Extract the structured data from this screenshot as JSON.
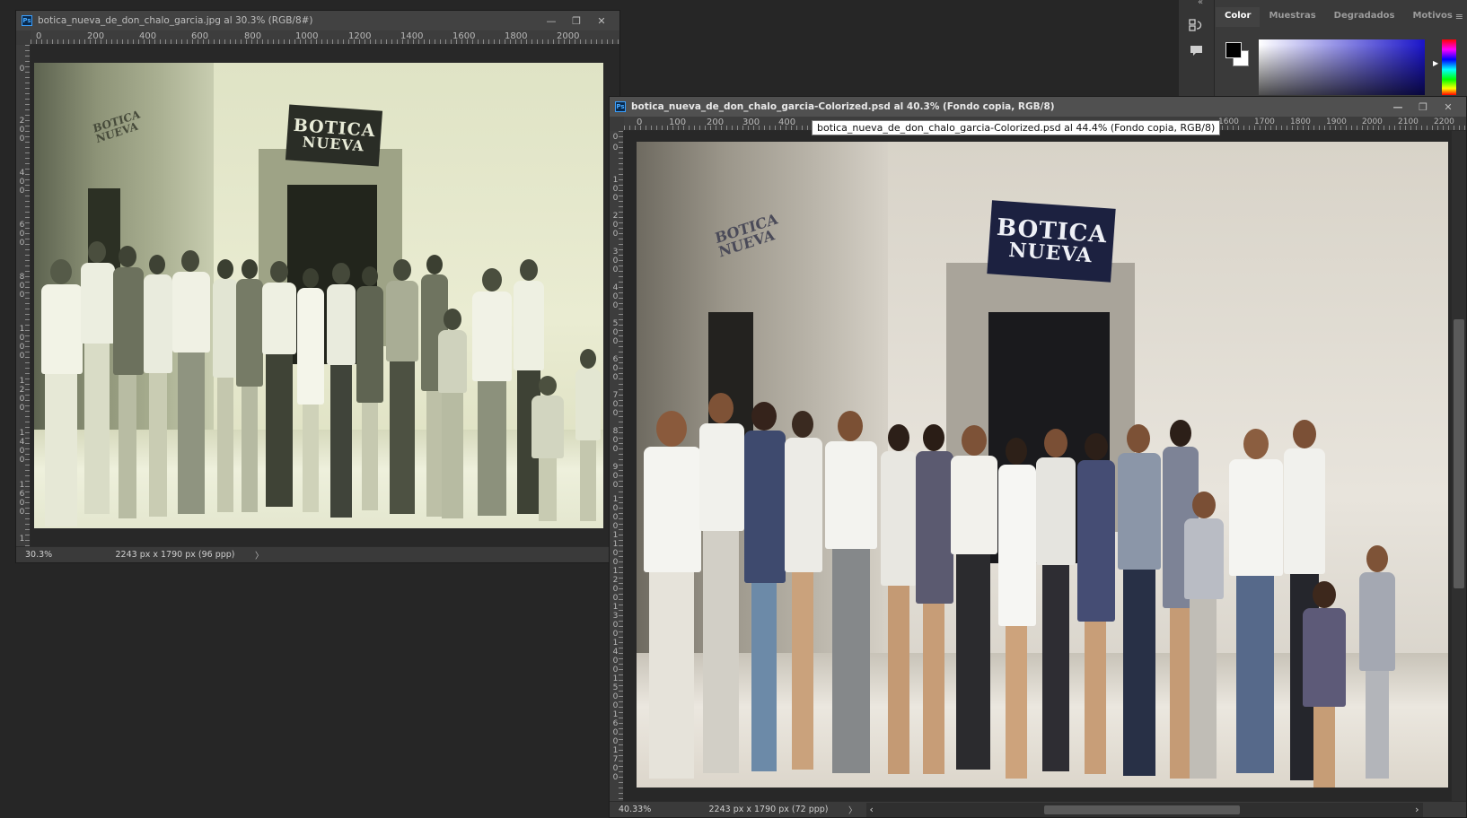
{
  "doc1": {
    "title": "botica_nueva_de_don_chalo_garcia.jpg al 30.3% (RGB/8#)",
    "ruler_h": [
      "0",
      "200",
      "400",
      "600",
      "800",
      "1000",
      "1200",
      "1400",
      "1600",
      "1800",
      "2000"
    ],
    "ruler_v": [
      "0",
      "200",
      "400",
      "600",
      "800",
      "1000",
      "1200",
      "1400",
      "1600",
      "1"
    ],
    "zoom": "30.3%",
    "info": "2243 px x 1790 px (96 ppp)",
    "arrow": "〉",
    "sign_line1": "BOTICA",
    "sign_line2": "NUEVA",
    "side_sign_line1": "BOTICA",
    "side_sign_line2": "NUEVA"
  },
  "doc2": {
    "title": "botica_nueva_de_don_chalo_garcia-Colorized.psd al 40.3% (Fondo copia, RGB/8)",
    "ruler_h_left": [
      "0",
      "100",
      "200",
      "300",
      "400"
    ],
    "ruler_h_right": [
      "1600",
      "1700",
      "1800",
      "1900",
      "2000",
      "2100",
      "2200"
    ],
    "ruler_v": [
      "0",
      "0",
      "100",
      "200",
      "300",
      "400",
      "500",
      "600",
      "700",
      "800",
      "900",
      "1000",
      "1100",
      "1200",
      "1300",
      "1400",
      "1500",
      "1600",
      "1700"
    ],
    "tooltip": "botica_nueva_de_don_chalo_garcia-Colorized.psd al 44.4% (Fondo copia, RGB/8)",
    "zoom": "40.33%",
    "info": "2243 px x 1790 px (72 ppp)",
    "arrow": "〉",
    "scroll_left": "‹",
    "scroll_right": "›",
    "sign_line1": "BOTICA",
    "sign_line2": "NUEVA",
    "side_sign_line1": "BOTICA",
    "side_sign_line2": "NUEVA"
  },
  "window_buttons": {
    "minimize": "—",
    "maximize": "❐",
    "close": "✕"
  },
  "color_panel": {
    "tabs": [
      "Color",
      "Muestras",
      "Degradados",
      "Motivos"
    ],
    "active_tab": "Color",
    "menu_icon": "≡",
    "collapse": "«",
    "foreground": "#000000",
    "background": "#ffffff"
  },
  "icons": {
    "history": "history-brush-icon",
    "comment": "comment-icon"
  }
}
